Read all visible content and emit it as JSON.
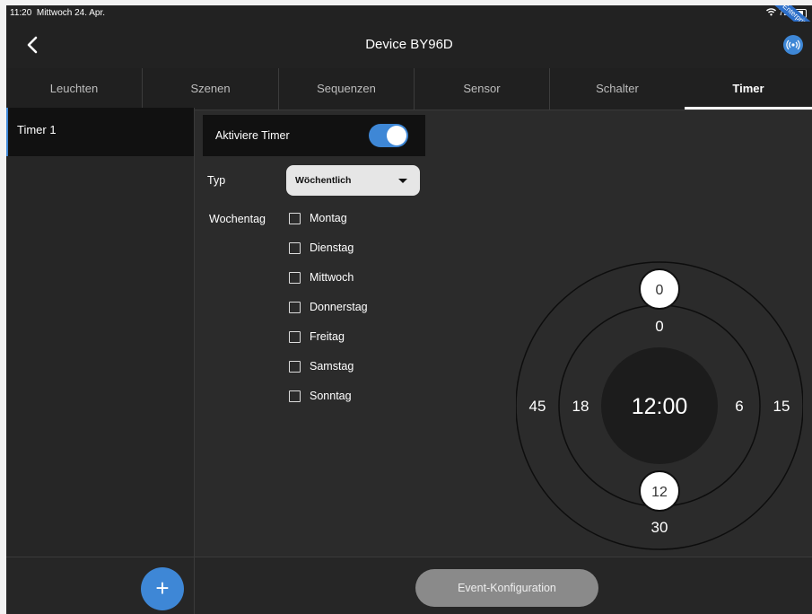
{
  "status": {
    "time": "11:20",
    "date": "Mittwoch 24. Apr.",
    "battery": "72",
    "badge": "Enterprise"
  },
  "header": {
    "title": "Device BY96D",
    "back_icon": "chevron-left-icon",
    "device_icon": "broadcast-icon"
  },
  "tabs": [
    {
      "label": "Leuchten"
    },
    {
      "label": "Szenen"
    },
    {
      "label": "Sequenzen"
    },
    {
      "label": "Sensor"
    },
    {
      "label": "Schalter"
    },
    {
      "label": "Timer",
      "active": true
    }
  ],
  "sidebar": {
    "items": [
      {
        "label": "Timer 1",
        "selected": true
      }
    ]
  },
  "form": {
    "activate_label": "Aktiviere Timer",
    "activate_on": true,
    "typ_label": "Typ",
    "typ_value": "Wöchentlich",
    "weekday_label": "Wochentag",
    "days": [
      {
        "label": "Montag",
        "checked": false
      },
      {
        "label": "Dienstag",
        "checked": false
      },
      {
        "label": "Mittwoch",
        "checked": false
      },
      {
        "label": "Donnerstag",
        "checked": false
      },
      {
        "label": "Freitag",
        "checked": false
      },
      {
        "label": "Samstag",
        "checked": false
      },
      {
        "label": "Sonntag",
        "checked": false
      }
    ]
  },
  "clock": {
    "time": "12:00",
    "outer_labels": {
      "top": "0",
      "right": "15",
      "bottom": "30",
      "left": "45"
    },
    "inner_labels": {
      "top": "0",
      "right": "6",
      "bottom": "12",
      "left": "18"
    },
    "hour_handle": "12",
    "minute_handle": "0"
  },
  "footer": {
    "add_icon": "plus-icon",
    "event_button": "Event-Konfiguration"
  },
  "colors": {
    "accent": "#3e87d6",
    "background": "#2b2b2b",
    "panel": "#111111"
  }
}
